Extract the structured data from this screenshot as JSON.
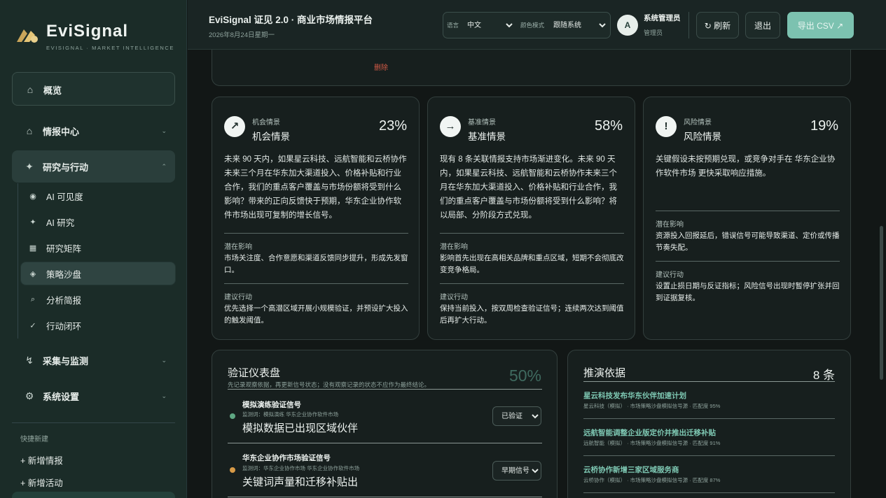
{
  "brand": {
    "name": "EviSignal",
    "tagline": "EVISIGNAL · MARKET INTELLIGENCE"
  },
  "sidebar": {
    "overview": {
      "icon": "home-icon",
      "label": "概览"
    },
    "intel": {
      "icon": "home-icon",
      "label": "情报中心",
      "caret": "⌄"
    },
    "research": {
      "icon": "sparkle-icon",
      "label": "研究与行动",
      "caret": "⌃"
    },
    "research_items": [
      {
        "icon": "eye-icon",
        "label": "AI 可见度"
      },
      {
        "icon": "sparkle-icon",
        "label": "AI 研究"
      },
      {
        "icon": "matrix-icon",
        "label": "研究矩阵"
      },
      {
        "icon": "diamond-icon",
        "label": "策略沙盘"
      },
      {
        "icon": "search-icon",
        "label": "分析简报"
      },
      {
        "icon": "check-icon",
        "label": "行动闭环"
      }
    ],
    "collect": {
      "icon": "pulse-icon",
      "label": "采集与监测",
      "caret": "⌄"
    },
    "settings": {
      "icon": "gear-icon",
      "label": "系统设置",
      "caret": "⌄"
    },
    "quick_title": "快捷新建",
    "quick_items": [
      "+ 新增情报",
      "+ 新增活动"
    ]
  },
  "header": {
    "title": "EviSignal 证见 2.0 · 商业市场情报平台",
    "date": "2026年8月24日星期一",
    "language_label": "语言",
    "language_value": "中文",
    "theme_label": "颜色模式",
    "theme_value": "跟随系统",
    "avatar_letter": "A",
    "user_name": "系统管理员",
    "user_role": "管理员",
    "refresh_label": "↻ 刷新",
    "logout_label": "退出",
    "export_label": "导出 CSV ↗"
  },
  "main": {
    "delete_label": "删除",
    "scenarios": [
      {
        "icon": "trend-up-icon",
        "glyph": "↗",
        "small": "机会情景",
        "title": "机会情景",
        "pct": "23%",
        "body": "未来 90 天内，如果星云科技、远航智能和云桥协作未来三个月在华东加大渠道投入、价格补贴和行业合作，我们的重点客户覆盖与市场份额将受到什么影响？带来的正向反馈快于预期，华东企业协作软件市场出现可复制的增长信号。",
        "impact_h": "潜在影响",
        "impact": "市场关注度、合作意愿和渠道反馈同步提升，形成先发窗口。",
        "action_h": "建议行动",
        "action": "优先选择一个高潜区域开展小规模验证，并预设扩大投入的触发阈值。"
      },
      {
        "icon": "arrow-right-icon",
        "glyph": "→",
        "small": "基准情景",
        "title": "基准情景",
        "pct": "58%",
        "body": "现有 8 条关联情报支持市场渐进变化。未来 90 天内，如果星云科技、远航智能和云桥协作未来三个月在华东加大渠道投入、价格补贴和行业合作，我们的重点客户覆盖与市场份额将受到什么影响？将以局部、分阶段方式兑现。",
        "impact_h": "潜在影响",
        "impact": "影响首先出现在高相关品牌和重点区域，短期不会彻底改变竞争格局。",
        "action_h": "建议行动",
        "action": "保持当前投入，按双周检查验证信号；连续两次达到阈值后再扩大行动。"
      },
      {
        "icon": "alert-icon",
        "glyph": "!",
        "small": "风险情景",
        "title": "风险情景",
        "pct": "19%",
        "body": "关键假设未按预期兑现，或竞争对手在 华东企业协作软件市场 更快采取响应措施。",
        "impact_h": "潜在影响",
        "impact": "资源投入回报延后，错误信号可能导致渠道、定价或传播节奏失配。",
        "action_h": "建议行动",
        "action": "设置止损日期与反证指标；风险信号出现时暂停扩张并回到证据复核。"
      }
    ],
    "validation": {
      "title": "验证仪表盘",
      "subtitle": "先记录观察依据，再更新信号状态；没有观察记录的状态不应作为最终结论。",
      "pct": "50%",
      "items": [
        {
          "title": "模拟演练验证信号",
          "meta": "监测词：模拟演练 华东企业协作软件市场",
          "main": "模拟数据已出现区域伙伴",
          "status": "已验证",
          "dot": "#5fa783"
        },
        {
          "title": "华东企业协作市场验证信号",
          "meta": "监测词：华东企业协作市场 华东企业协作软件市场",
          "main": "关键词声量和迁移补贴出",
          "status": "早期信号",
          "dot": "#d79a47"
        }
      ]
    },
    "evidence": {
      "title": "推演依据",
      "count": "8 条",
      "items": [
        {
          "title": "星云科技发布华东伙伴加速计划",
          "meta": "星云科技（模拟） · 市场策略沙盘模拟信号源 · 匹配度 95%"
        },
        {
          "title": "远航智能调整企业版定价并推出迁移补贴",
          "meta": "远航智能（模拟） · 市场策略沙盘模拟信号源 · 匹配度 91%"
        },
        {
          "title": "云桥协作新增三家区域服务商",
          "meta": "云桥协作（模拟） · 市场策略沙盘模拟信号源 · 匹配度 87%"
        }
      ]
    }
  }
}
